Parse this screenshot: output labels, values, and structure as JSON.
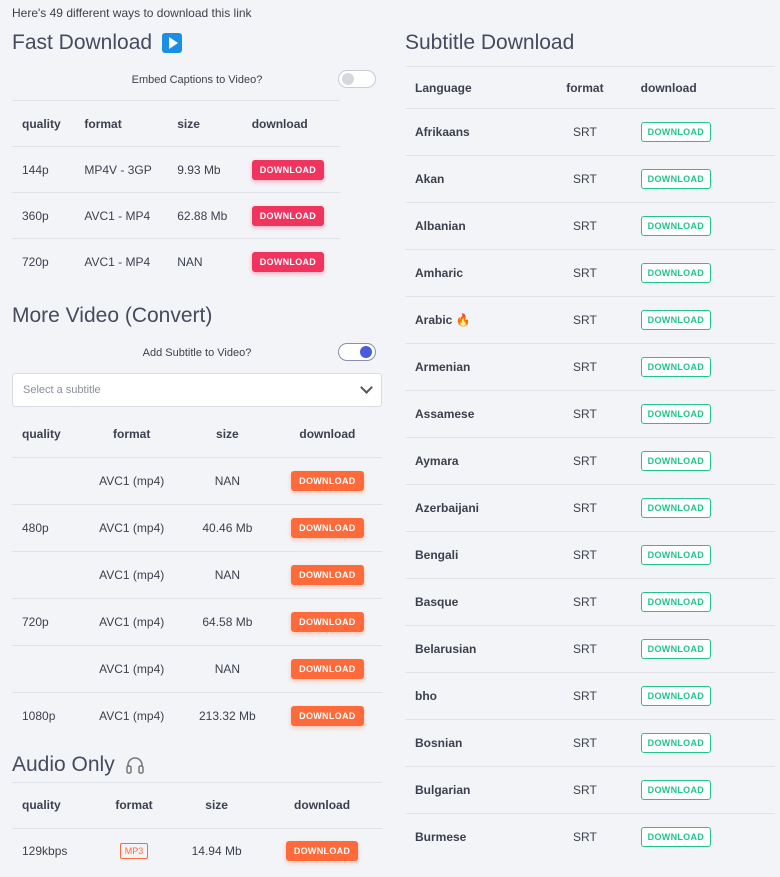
{
  "intro": "Here's 49 different ways to download this link",
  "fast": {
    "title": "Fast Download",
    "toggle_label": "Embed Captions to Video?",
    "headers": [
      "quality",
      "format",
      "size",
      "download"
    ],
    "rows": [
      {
        "quality": "144p",
        "format": "MP4V - 3GP",
        "size": "9.93 Mb",
        "button": "DOWNLOAD"
      },
      {
        "quality": "360p",
        "format": "AVC1 - MP4",
        "size": "62.88 Mb",
        "button": "DOWNLOAD"
      },
      {
        "quality": "720p",
        "format": "AVC1 - MP4",
        "size": "NAN",
        "button": "DOWNLOAD"
      }
    ]
  },
  "more": {
    "title": "More Video (Convert)",
    "toggle_label": "Add Subtitle to Video?",
    "select_placeholder": "Select a subtitle",
    "headers": [
      "quality",
      "format",
      "size",
      "download"
    ],
    "rows": [
      {
        "quality": "",
        "format": "AVC1 (mp4)",
        "size": "NAN",
        "button": "DOWNLOAD"
      },
      {
        "quality": "480p",
        "format": "AVC1 (mp4)",
        "size": "40.46 Mb",
        "button": "DOWNLOAD"
      },
      {
        "quality": "",
        "format": "AVC1 (mp4)",
        "size": "NAN",
        "button": "DOWNLOAD"
      },
      {
        "quality": "720p",
        "format": "AVC1 (mp4)",
        "size": "64.58 Mb",
        "button": "DOWNLOAD"
      },
      {
        "quality": "",
        "format": "AVC1 (mp4)",
        "size": "NAN",
        "button": "DOWNLOAD"
      },
      {
        "quality": "1080p",
        "format": "AVC1 (mp4)",
        "size": "213.32 Mb",
        "button": "DOWNLOAD"
      }
    ]
  },
  "audio": {
    "title": "Audio Only",
    "headers": [
      "quality",
      "format",
      "size",
      "download"
    ],
    "rows": [
      {
        "quality": "129kbps",
        "format": "MP3",
        "size": "14.94 Mb",
        "button": "DOWNLOAD"
      }
    ]
  },
  "subtitles": {
    "title": "Subtitle Download",
    "headers": [
      "Language",
      "format",
      "download"
    ],
    "rows": [
      {
        "language": "Afrikaans",
        "format": "SRT",
        "button": "DOWNLOAD"
      },
      {
        "language": "Akan",
        "format": "SRT",
        "button": "DOWNLOAD"
      },
      {
        "language": "Albanian",
        "format": "SRT",
        "button": "DOWNLOAD"
      },
      {
        "language": "Amharic",
        "format": "SRT",
        "button": "DOWNLOAD"
      },
      {
        "language": "Arabic",
        "format": "SRT",
        "button": "DOWNLOAD",
        "hot": true
      },
      {
        "language": "Armenian",
        "format": "SRT",
        "button": "DOWNLOAD"
      },
      {
        "language": "Assamese",
        "format": "SRT",
        "button": "DOWNLOAD"
      },
      {
        "language": "Aymara",
        "format": "SRT",
        "button": "DOWNLOAD"
      },
      {
        "language": "Azerbaijani",
        "format": "SRT",
        "button": "DOWNLOAD"
      },
      {
        "language": "Bengali",
        "format": "SRT",
        "button": "DOWNLOAD"
      },
      {
        "language": "Basque",
        "format": "SRT",
        "button": "DOWNLOAD"
      },
      {
        "language": "Belarusian",
        "format": "SRT",
        "button": "DOWNLOAD"
      },
      {
        "language": "bho",
        "format": "SRT",
        "button": "DOWNLOAD"
      },
      {
        "language": "Bosnian",
        "format": "SRT",
        "button": "DOWNLOAD"
      },
      {
        "language": "Bulgarian",
        "format": "SRT",
        "button": "DOWNLOAD"
      },
      {
        "language": "Burmese",
        "format": "SRT",
        "button": "DOWNLOAD"
      }
    ]
  },
  "colors": {
    "fast_button": "#f0345e",
    "convert_button": "#ff6a3a",
    "subtitle_button": "#21c48a",
    "play_icon": "#1a8fe3"
  }
}
